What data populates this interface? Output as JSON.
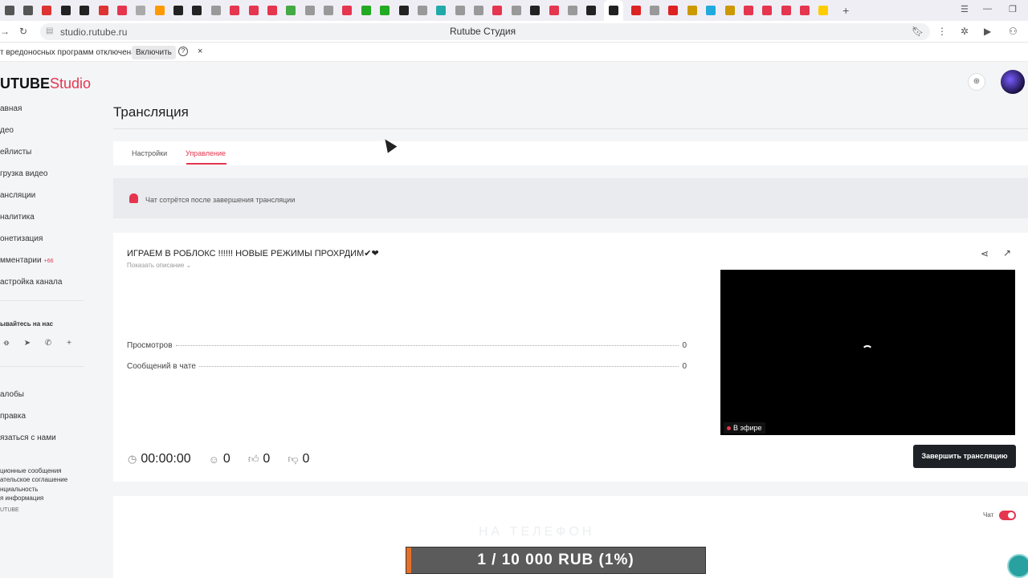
{
  "browser": {
    "tab_icon_colors": [
      "#555",
      "#555",
      "#d33",
      "#222",
      "#222",
      "#d33",
      "#e5354f",
      "#aaa",
      "#f90",
      "#222",
      "#222",
      "#999",
      "#e5354f",
      "#e5354f",
      "#e5354f",
      "#4a4",
      "#999",
      "#999",
      "#e5354f",
      "#2a2",
      "#2a2",
      "#222",
      "#999",
      "#2aa",
      "#999",
      "#999",
      "#e5354f",
      "#999",
      "#222",
      "#e5354f",
      "#999",
      "#222",
      "#d22",
      "#999",
      "#d22",
      "#c90",
      "#2ad",
      "#c90",
      "#e5354f",
      "#e5354f",
      "#e5354f",
      "#e5354f",
      "#fc0"
    ],
    "url": "studio.rutube.ru",
    "page_title": "Rutube Студия"
  },
  "infobar": {
    "message": "т вредоносных программ отключена",
    "enable_label": "Включить",
    "help": "?",
    "close": "×"
  },
  "logo": {
    "brand": "UTUBE",
    "studio": "Studio"
  },
  "sidebar": {
    "items": [
      {
        "label": "авная"
      },
      {
        "label": "део"
      },
      {
        "label": "ейлисты"
      },
      {
        "label": "грузка видео"
      },
      {
        "label": "ансляции"
      },
      {
        "label": "налитика"
      },
      {
        "label": "онетизация"
      },
      {
        "label": "мментарии",
        "badge": "+66"
      },
      {
        "label": "астройка канала"
      }
    ],
    "follow_title": "ывайтесь на нас",
    "socials": [
      "ok-icon",
      "telegram-icon",
      "viber-icon",
      "plus-icon"
    ],
    "items2": [
      {
        "label": "алобы"
      },
      {
        "label": "правка"
      },
      {
        "label": "язаться с нами"
      }
    ],
    "legal": [
      "ционные сообщения",
      "ательское соглашение",
      "нциальность",
      "я информация"
    ],
    "copyright": "UTUBE"
  },
  "page": {
    "title": "Трансляция"
  },
  "tabs": [
    {
      "label": "Настройки",
      "active": false
    },
    {
      "label": "Управление",
      "active": true
    }
  ],
  "notice": {
    "text": "Чат сотрётся после завершения трансляции"
  },
  "stream": {
    "title": "ИГРАЕМ В РОБЛОКС !!!!!! НОВЫЕ РЕЖИМЫ ПРОХРДИМ✔❤",
    "show_description": "Показать описание ⌄",
    "stats": [
      {
        "label": "Просмотров",
        "value": "0"
      },
      {
        "label": "Сообщений в чате",
        "value": "0"
      }
    ],
    "live_badge": "В эфире",
    "duration": "00:00:00",
    "viewers": "0",
    "likes": "0",
    "dislikes": "0",
    "end_button": "Завершить трансляцию"
  },
  "chat": {
    "label": "Чат",
    "enabled": true,
    "watermark": "НА ТЕЛЕФОН"
  },
  "donation": {
    "text": "1 / 10 000 RUB (1%)",
    "progress": 0.01
  },
  "colors": {
    "accent": "#e5354f",
    "button_dark": "#1e2227"
  }
}
